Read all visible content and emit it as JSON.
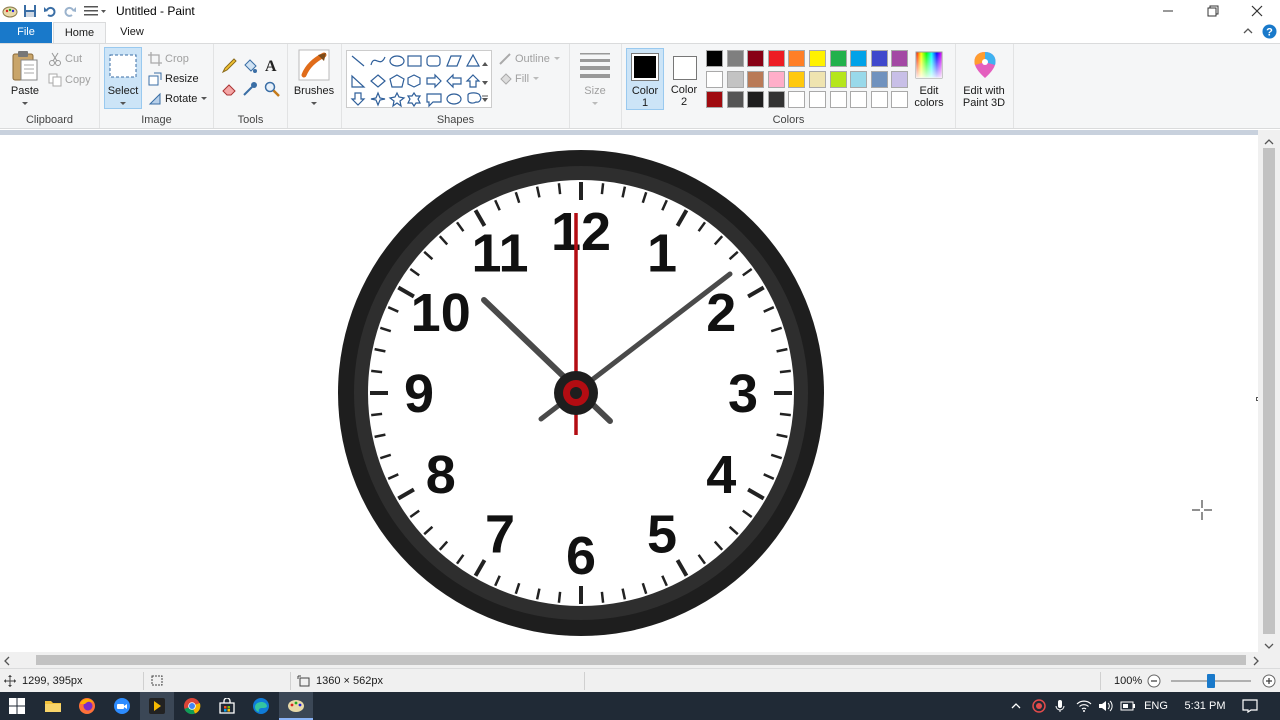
{
  "window": {
    "title": "Untitled - Paint"
  },
  "tabs": [
    {
      "label": "File"
    },
    {
      "label": "Home"
    },
    {
      "label": "View"
    }
  ],
  "ribbon": {
    "clipboard": {
      "group": "Clipboard",
      "paste": "Paste",
      "cut": "Cut",
      "copy": "Copy"
    },
    "image": {
      "group": "Image",
      "select": "Select",
      "crop": "Crop",
      "resize": "Resize",
      "rotate": "Rotate"
    },
    "tools": {
      "group": "Tools"
    },
    "brushes": {
      "label": "Brushes"
    },
    "shapes": {
      "group": "Shapes",
      "outline": "Outline",
      "fill": "Fill"
    },
    "size": {
      "label": "Size"
    },
    "colors": {
      "group": "Colors",
      "color1": "Color 1",
      "color1_line1": "Color",
      "color1_line2": "1",
      "color2_line1": "Color",
      "color2_line2": "2",
      "color1_value": "#000000",
      "color2_value": "#ffffff",
      "palette_row1": [
        "#000000",
        "#7f7f7f",
        "#880015",
        "#ed1c24",
        "#ff7f27",
        "#fff200",
        "#22b14c",
        "#00a2e8",
        "#3f48cc",
        "#a349a4"
      ],
      "palette_row2": [
        "#ffffff",
        "#c3c3c3",
        "#b97a57",
        "#ffaec9",
        "#ffc90e",
        "#efe4b0",
        "#b5e61d",
        "#99d9ea",
        "#7092be",
        "#c8bfe7"
      ],
      "palette_row3": [
        "#a00b10",
        "#555555",
        "#1e1e1e",
        "#333333",
        "#ffffff",
        "#ffffff",
        "#ffffff",
        "#ffffff",
        "#ffffff",
        "#ffffff"
      ],
      "edit_line1": "Edit",
      "edit_line2": "colors"
    },
    "paint3d": {
      "line1": "Edit with",
      "line2": "Paint 3D"
    }
  },
  "clock": {
    "numbers": [
      "12",
      "1",
      "2",
      "3",
      "4",
      "5",
      "6",
      "7",
      "8",
      "9",
      "10",
      "11"
    ],
    "hour_hand_color": "#4a4a4a",
    "second_hand_color": "#b30c12"
  },
  "status": {
    "cursor_pos": "1299, 395px",
    "canvas_size": "1360 × 562px",
    "zoom": "100%"
  },
  "taskbar": {
    "lang": "ENG",
    "time": "5:31 PM"
  }
}
